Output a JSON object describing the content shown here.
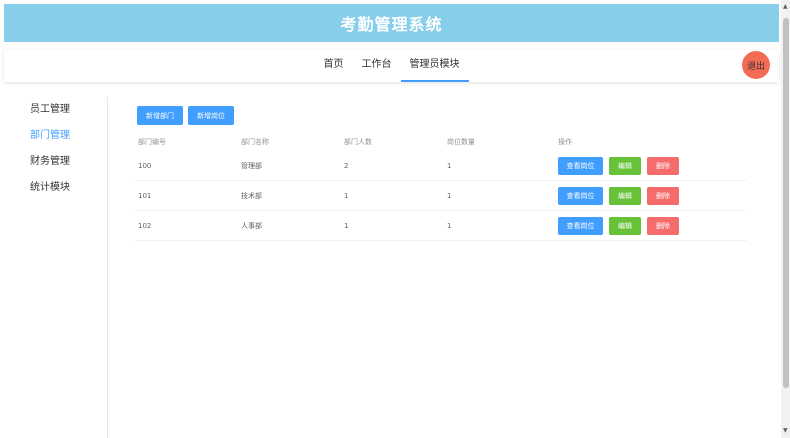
{
  "header": {
    "title": "考勤管理系统"
  },
  "nav": {
    "tabs": [
      {
        "label": "首页"
      },
      {
        "label": "工作台"
      },
      {
        "label": "管理员模块"
      }
    ],
    "logout_label": "退出"
  },
  "sidebar": {
    "items": [
      {
        "label": "员工管理"
      },
      {
        "label": "部门管理"
      },
      {
        "label": "财务管理"
      },
      {
        "label": "统计模块"
      }
    ]
  },
  "toolbar": {
    "add_dept_label": "新增部门",
    "add_post_label": "新增岗位"
  },
  "table": {
    "headers": [
      "部门编号",
      "部门名称",
      "部门人数",
      "岗位数量",
      "操作"
    ],
    "rows": [
      {
        "id": "100",
        "name": "管理部",
        "people": "2",
        "posts": "1"
      },
      {
        "id": "101",
        "name": "技术部",
        "people": "1",
        "posts": "1"
      },
      {
        "id": "102",
        "name": "人事部",
        "people": "1",
        "posts": "1"
      }
    ],
    "actions": {
      "view_label": "查看岗位",
      "edit_label": "编辑",
      "delete_label": "删除"
    }
  },
  "colors": {
    "header_bg": "#87ceeb",
    "primary": "#409eff",
    "success": "#67c23a",
    "danger": "#f56c6c",
    "logout": "#f56c55"
  }
}
